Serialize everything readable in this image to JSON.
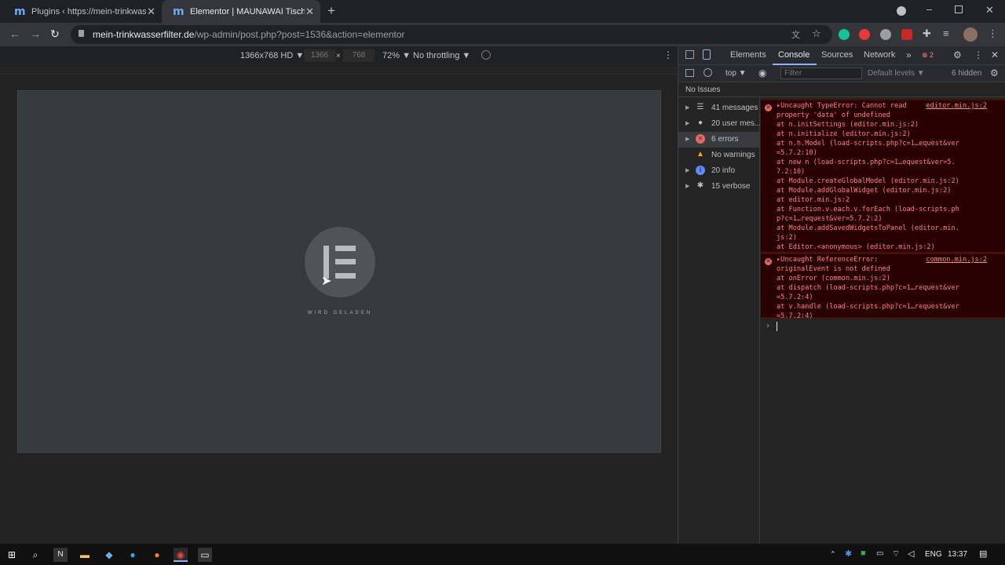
{
  "browser": {
    "tabs": [
      {
        "title": "Plugins ‹ https://mein-trinkwasserfilter.de",
        "favicon": "m"
      },
      {
        "title": "Elementor | MAUNAWAI Tischwasserfilter",
        "favicon": "m"
      }
    ],
    "url_domain": "mein-trinkwasserfilter.de",
    "url_path": "/wp-admin/post.php?post=1536&action=elementor"
  },
  "device_toolbar": {
    "device": "1366x768 HD ▼",
    "width": "1366",
    "height": "768",
    "zoom": "72% ▼",
    "throttling": "No throttling ▼"
  },
  "page": {
    "loading_text": "WIRD GELADEN"
  },
  "devtools": {
    "tabs": [
      "Elements",
      "Console",
      "Sources",
      "Network"
    ],
    "error_badge": "2",
    "context": "top ▼",
    "filter_placeholder": "Filter",
    "levels": "Default levels ▼",
    "hidden": "6 hidden",
    "issues": "No Issues",
    "sidebar": [
      {
        "label": "41 messages",
        "icon": "list-icon",
        "color": "#9aa0a6"
      },
      {
        "label": "20 user mes...",
        "icon": "user-icon",
        "color": "#9aa0a6"
      },
      {
        "label": "6 errors",
        "icon": "error-icon",
        "color": "#e46962"
      },
      {
        "label": "No warnings",
        "icon": "warning-icon",
        "color": "#f2b600"
      },
      {
        "label": "20 info",
        "icon": "info-icon",
        "color": "#5c8df6"
      },
      {
        "label": "15 verbose",
        "icon": "bug-icon",
        "color": "#9aa0a6"
      }
    ],
    "errors": [
      {
        "source": "editor.min.js:2",
        "lines": [
          "▸Uncaught TypeError: Cannot read",
          "property 'data' of undefined",
          "    at n.initSettings (editor.min.js:2)",
          "    at n.initialize (editor.min.js:2)",
          "    at n.h.Model (load-scripts.php?c=1…equest&ver",
          "=5.7.2:10)",
          "    at new n (load-scripts.php?c=1…equest&ver=5.",
          "7.2:10)",
          "    at Module.createGlobalModel (editor.min.js:2)",
          "    at Module.addGlobalWidget (editor.min.js:2)",
          "    at editor.min.js:2",
          "    at Function.v.each.v.forEach (load-scripts.ph",
          "p?c=1…request&ver=5.7.2:2)",
          "    at Module.addSavedWidgetsToPanel (editor.min.",
          "js:2)",
          "    at Editor.<anonymous> (editor.min.js:2)"
        ]
      },
      {
        "source": "common.min.js:2",
        "lines": [
          "▸Uncaught ReferenceError:",
          "originalEvent is not defined",
          "    at onError (common.min.js:2)",
          "    at dispatch (load-scripts.php?c=1…request&ver",
          "=5.7.2:4)",
          "    at v.handle (load-scripts.php?c=1…request&ver",
          "=5.7.2:4)"
        ]
      }
    ]
  },
  "taskbar": {
    "lang": "ENG",
    "time": "13:37"
  }
}
